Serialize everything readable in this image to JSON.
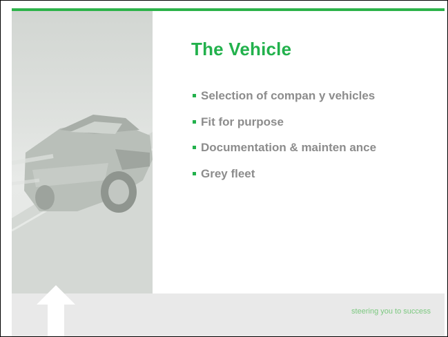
{
  "slide": {
    "title": "The Vehicle",
    "bullets": [
      "Selection of compan y vehicles",
      "Fit for purpose",
      "Documentation & mainten ance",
      "Grey fleet"
    ],
    "tagline": "steering you to success"
  },
  "colors": {
    "accent": "#22b14c",
    "bullet_text": "#8c8c8c",
    "footer_bg": "#e9e9e9"
  },
  "icons": [
    "car-photo",
    "up-arrow-icon"
  ]
}
